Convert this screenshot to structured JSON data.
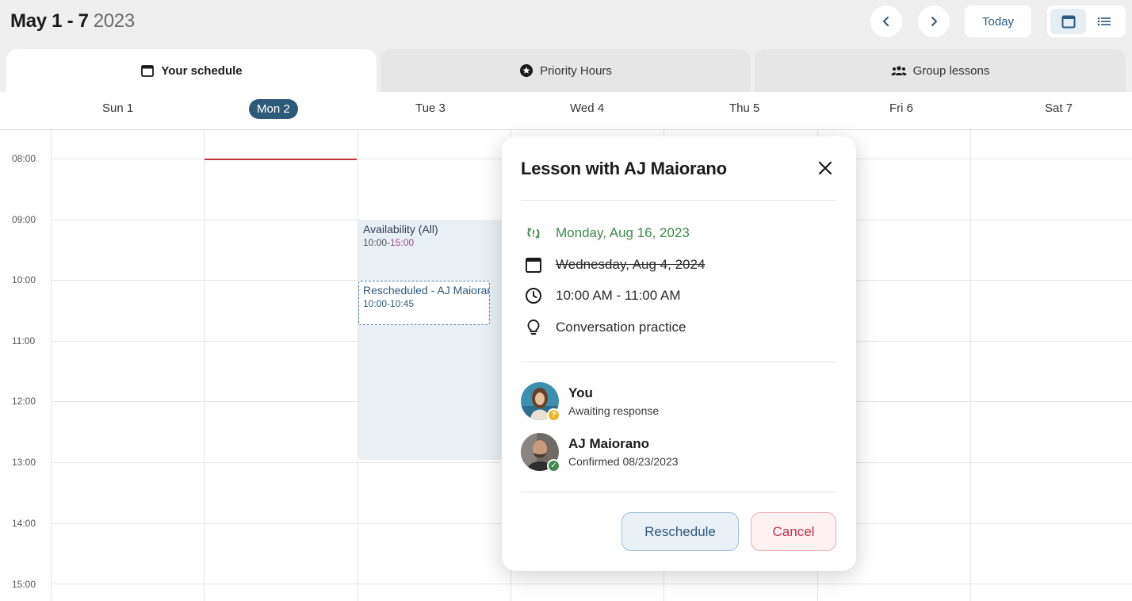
{
  "header": {
    "range_bold": "May 1 - 7",
    "range_year": "2023",
    "today_label": "Today"
  },
  "tabs": [
    {
      "label": "Your schedule",
      "icon": "calendar-icon",
      "active": true
    },
    {
      "label": "Priority Hours",
      "icon": "star-circle-icon",
      "active": false
    },
    {
      "label": "Group lessons",
      "icon": "group-icon",
      "active": false
    }
  ],
  "days": [
    "Sun 1",
    "Mon 2",
    "Tue 3",
    "Wed 4",
    "Thu 5",
    "Fri 6",
    "Sat 7"
  ],
  "times": [
    "08:00",
    "09:00",
    "10:00",
    "11:00",
    "12:00",
    "13:00",
    "14:00",
    "15:00"
  ],
  "events": {
    "availability": {
      "title": "Availability (All)",
      "time_start": "10:00-",
      "time_end": "15:00"
    },
    "rescheduled": {
      "title": "Rescheduled - AJ Maiorano",
      "time": "10:00-10:45"
    }
  },
  "modal": {
    "title": "Lesson with AJ Maiorano",
    "new_date": "Monday, Aug 16, 2023",
    "old_date": "Wednesday, Aug 4, 2024",
    "time": "10:00 AM - 11:00 AM",
    "topic": "Conversation practice",
    "participants": [
      {
        "name": "You",
        "status": "Awaiting response",
        "badge": "?",
        "badge_color": "#f0b429"
      },
      {
        "name": "AJ Maiorano",
        "status": "Confirmed 08/23/2023",
        "badge": "✓",
        "badge_color": "#3f8a4f"
      }
    ],
    "reschedule_label": "Reschedule",
    "cancel_label": "Cancel"
  },
  "colors": {
    "accent": "#2e5a7a",
    "now_line": "#c8323b",
    "green": "#3f8a4f",
    "danger": "#c23342"
  }
}
